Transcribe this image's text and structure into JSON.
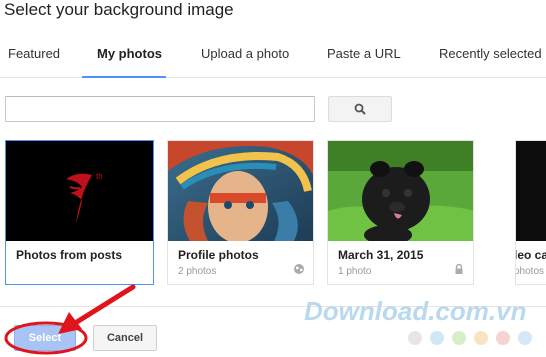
{
  "dialog": {
    "title": "Select your background image"
  },
  "tabs": [
    {
      "label": "Featured",
      "active": false
    },
    {
      "label": "My photos",
      "active": true
    },
    {
      "label": "Upload a photo",
      "active": false
    },
    {
      "label": "Paste a URL",
      "active": false
    },
    {
      "label": "Recently selected",
      "active": false
    }
  ],
  "search": {
    "value": "",
    "button_icon": "search-icon"
  },
  "albums": [
    {
      "title": "Photos from posts",
      "subtitle": "",
      "icon": "",
      "selected": true
    },
    {
      "title": "Profile photos",
      "subtitle": "2 photos",
      "icon": "globe-icon",
      "selected": false
    },
    {
      "title": "March 31, 2015",
      "subtitle": "1 photo",
      "icon": "lock-icon",
      "selected": false
    },
    {
      "title": "leo ca",
      "subtitle": "photos",
      "icon": "",
      "selected": false
    }
  ],
  "buttons": {
    "select_label": "Select",
    "cancel_label": "Cancel"
  },
  "watermark": {
    "text": "Download.com.vn",
    "dot_colors": [
      "#e6e6e6",
      "#cfe8f5",
      "#d7efc9",
      "#fbe2c2",
      "#f7d2d2",
      "#d6e7f7"
    ]
  },
  "colors": {
    "accent": "#4d90fe",
    "select_button": "#a7c4f5",
    "annotation": "#e0141c"
  }
}
